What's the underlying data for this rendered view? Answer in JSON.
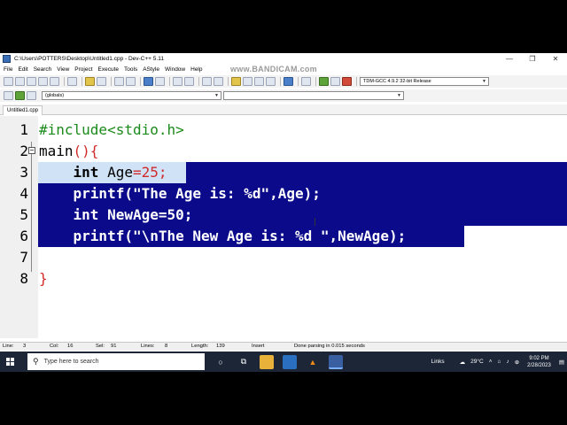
{
  "window": {
    "title": "C:\\Users\\POTTERS\\Desktop\\Untitled1.cpp - Dev-C++ 5.11",
    "watermark": "www.BANDICAM.com"
  },
  "menu": [
    "File",
    "Edit",
    "Search",
    "View",
    "Project",
    "Execute",
    "Tools",
    "AStyle",
    "Window",
    "Help"
  ],
  "toolbar": {
    "compiler": "TDM-GCC 4.9.2 32-bit Release",
    "scope": "(globals)"
  },
  "tab": {
    "label": "Untitled1.cpp"
  },
  "editor": {
    "lines": [
      {
        "num": "1",
        "text": "#include<stdio.h>"
      },
      {
        "num": "2",
        "text": "main(){"
      },
      {
        "num": "3",
        "text": "    int Age=25;"
      },
      {
        "num": "4",
        "text": "    printf(\"The Age is: %d\",Age);"
      },
      {
        "num": "5",
        "text": "    int NewAge=50;"
      },
      {
        "num": "6",
        "text": "    printf(\"\\nThe New Age is: %d \",NewAge);"
      },
      {
        "num": "7",
        "text": ""
      },
      {
        "num": "8",
        "text": "}"
      }
    ],
    "fold_symbol": "−"
  },
  "status": {
    "line": "Line:",
    "line_val": "3",
    "col": "Col:",
    "col_val": "16",
    "sel": "Sel:",
    "sel_val": "91",
    "lines": "Lines:",
    "lines_val": "8",
    "length": "Length:",
    "length_val": "139",
    "mode": "Insert",
    "message": "Done parsing in 0.015 seconds"
  },
  "taskbar": {
    "search_placeholder": "Type here to search",
    "links": "Links",
    "weather": "29°C",
    "time": "9:02 PM",
    "date": "2/28/2023"
  },
  "colors": {
    "selection": "#0a0a8a",
    "current_line": "#cfe2f6",
    "preprocessor": "#1a8a1a",
    "symbol": "#d12a2a"
  }
}
